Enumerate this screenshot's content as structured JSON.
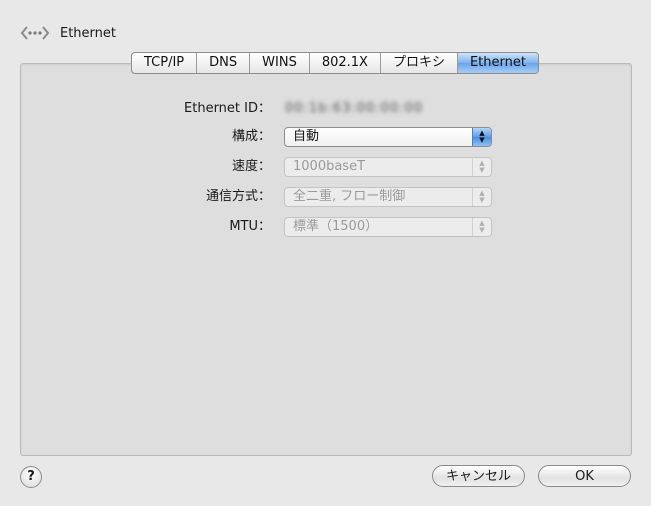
{
  "header": {
    "title": "Ethernet",
    "icon": "network-arrows-icon"
  },
  "tabs": [
    {
      "label": "TCP/IP",
      "active": false
    },
    {
      "label": "DNS",
      "active": false
    },
    {
      "label": "WINS",
      "active": false
    },
    {
      "label": "802.1X",
      "active": false
    },
    {
      "label": "プロキシ",
      "active": false
    },
    {
      "label": "Ethernet",
      "active": true
    }
  ],
  "form": {
    "ethernet_id": {
      "label": "Ethernet ID：",
      "value": "00:1b:63:00:00:00"
    },
    "config": {
      "label": "構成：",
      "value": "自動"
    },
    "speed": {
      "label": "速度：",
      "value": "1000baseT"
    },
    "duplex": {
      "label": "通信方式：",
      "value": "全二重, フロー制御"
    },
    "mtu": {
      "label": "MTU：",
      "value": "標準（1500）"
    }
  },
  "footer": {
    "help": "?",
    "cancel": "キャンセル",
    "ok": "OK"
  },
  "colors": {
    "accent": "#6aa5ea",
    "window_bg": "#e8e8e8",
    "panel_bg": "#dedede"
  }
}
